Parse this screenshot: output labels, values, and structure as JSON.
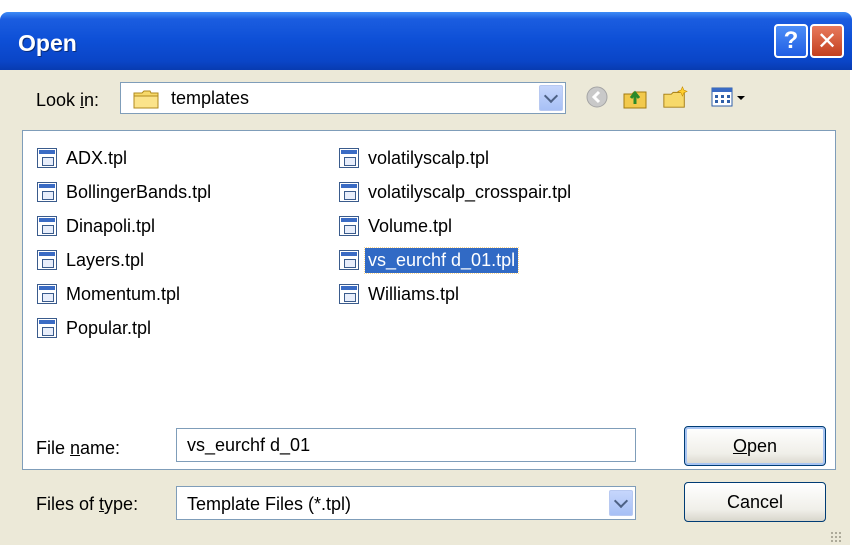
{
  "dialog": {
    "title": "Open"
  },
  "titlebar": {
    "help_glyph": "?",
    "close_glyph": "✕"
  },
  "lookin": {
    "label_pre": "Look ",
    "label_key": "i",
    "label_post": "n:",
    "value": "templates",
    "icon": "folder-icon"
  },
  "toolbar": {
    "back_icon": "back-icon",
    "up_icon": "up-one-level-icon",
    "newfolder_icon": "new-folder-icon",
    "views_icon": "views-menu-icon"
  },
  "files": {
    "column1": [
      "ADX.tpl",
      "BollingerBands.tpl",
      "Dinapoli.tpl",
      "Layers.tpl",
      "Momentum.tpl",
      "Popular.tpl"
    ],
    "column2": [
      "volatilyscalp.tpl",
      "volatilyscalp_crosspair.tpl",
      "Volume.tpl",
      "vs_eurchf d_01.tpl",
      "Williams.tpl"
    ],
    "selected": "vs_eurchf d_01.tpl"
  },
  "filename": {
    "label_pre": "File ",
    "label_key": "n",
    "label_post": "ame:",
    "value": "vs_eurchf d_01"
  },
  "filetype": {
    "label_pre": "Files of ",
    "label_key": "t",
    "label_post": "ype:",
    "value": "Template Files (*.tpl)"
  },
  "buttons": {
    "open_key": "O",
    "open_rest": "pen",
    "cancel": "Cancel"
  },
  "colors": {
    "titlebar": "#0a45c7",
    "selection": "#316ac5",
    "dialog_bg": "#ece9d8"
  }
}
